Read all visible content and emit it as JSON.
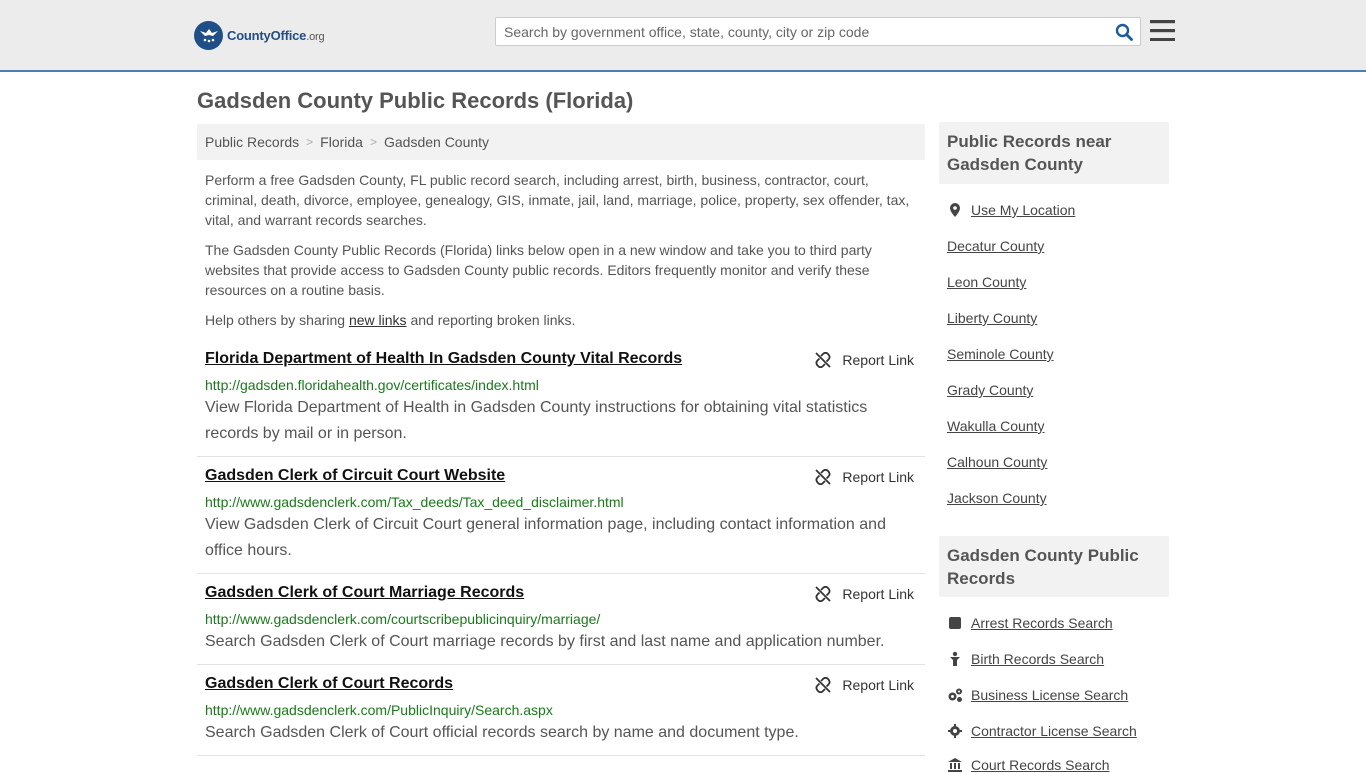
{
  "header": {
    "logo_name": "CountyOffice",
    "logo_tld": ".org",
    "search_placeholder": "Search by government office, state, county, city or zip code",
    "accent_color": "#4a7fb5"
  },
  "page_title": "Gadsden County Public Records (Florida)",
  "breadcrumb": [
    "Public Records",
    "Florida",
    "Gadsden County"
  ],
  "intro": {
    "p1": "Perform a free Gadsden County, FL public record search, including arrest, birth, business, contractor, court, criminal, death, divorce, employee, genealogy, GIS, inmate, jail, land, marriage, police, property, sex offender, tax, vital, and warrant records searches.",
    "p2": "The Gadsden County Public Records (Florida) links below open in a new window and take you to third party websites that provide access to Gadsden County public records. Editors frequently monitor and verify these resources on a routine basis.",
    "p3_before": "Help others by sharing ",
    "p3_link": "new links",
    "p3_after": " and reporting broken links."
  },
  "report_label": "Report Link",
  "records": [
    {
      "title": "Florida Department of Health In Gadsden County Vital Records",
      "url": "http://gadsden.floridahealth.gov/certificates/index.html",
      "desc": "View Florida Department of Health in Gadsden County instructions for obtaining vital statistics records by mail or in person."
    },
    {
      "title": "Gadsden Clerk of Circuit Court Website",
      "url": "http://www.gadsdenclerk.com/Tax_deeds/Tax_deed_disclaimer.html",
      "desc": "View Gadsden Clerk of Circuit Court general information page, including contact information and office hours."
    },
    {
      "title": "Gadsden Clerk of Court Marriage Records",
      "url": "http://www.gadsdenclerk.com/courtscribepublicinquiry/marriage/",
      "desc": "Search Gadsden Clerk of Court marriage records by first and last name and application number."
    },
    {
      "title": "Gadsden Clerk of Court Records",
      "url": "http://www.gadsdenclerk.com/PublicInquiry/Search.aspx",
      "desc": "Search Gadsden Clerk of Court official records search by name and document type."
    }
  ],
  "sidebar": {
    "nearby_title": "Public Records near Gadsden County",
    "use_location": "Use My Location",
    "nearby": [
      "Decatur County",
      "Leon County",
      "Liberty County",
      "Seminole County",
      "Grady County",
      "Wakulla County",
      "Calhoun County",
      "Jackson County"
    ],
    "county_title": "Gadsden County Public Records",
    "searches": [
      {
        "label": "Arrest Records Search",
        "icon": "handcuff-icon"
      },
      {
        "label": "Birth Records Search",
        "icon": "baby-icon"
      },
      {
        "label": "Business License Search",
        "icon": "gears-icon"
      },
      {
        "label": "Contractor License Search",
        "icon": "gear-icon"
      },
      {
        "label": "Court Records Search",
        "icon": "courthouse-icon"
      }
    ]
  }
}
